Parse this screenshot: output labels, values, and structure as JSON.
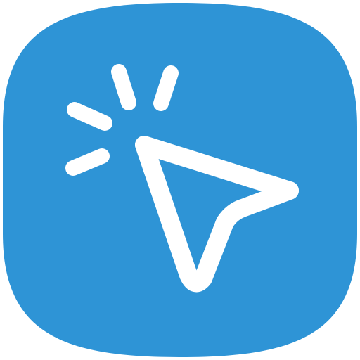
{
  "app_icon": {
    "name": "click-cursor-icon",
    "background_color": "#2E94D6",
    "glyph_color": "#FFFFFF"
  }
}
